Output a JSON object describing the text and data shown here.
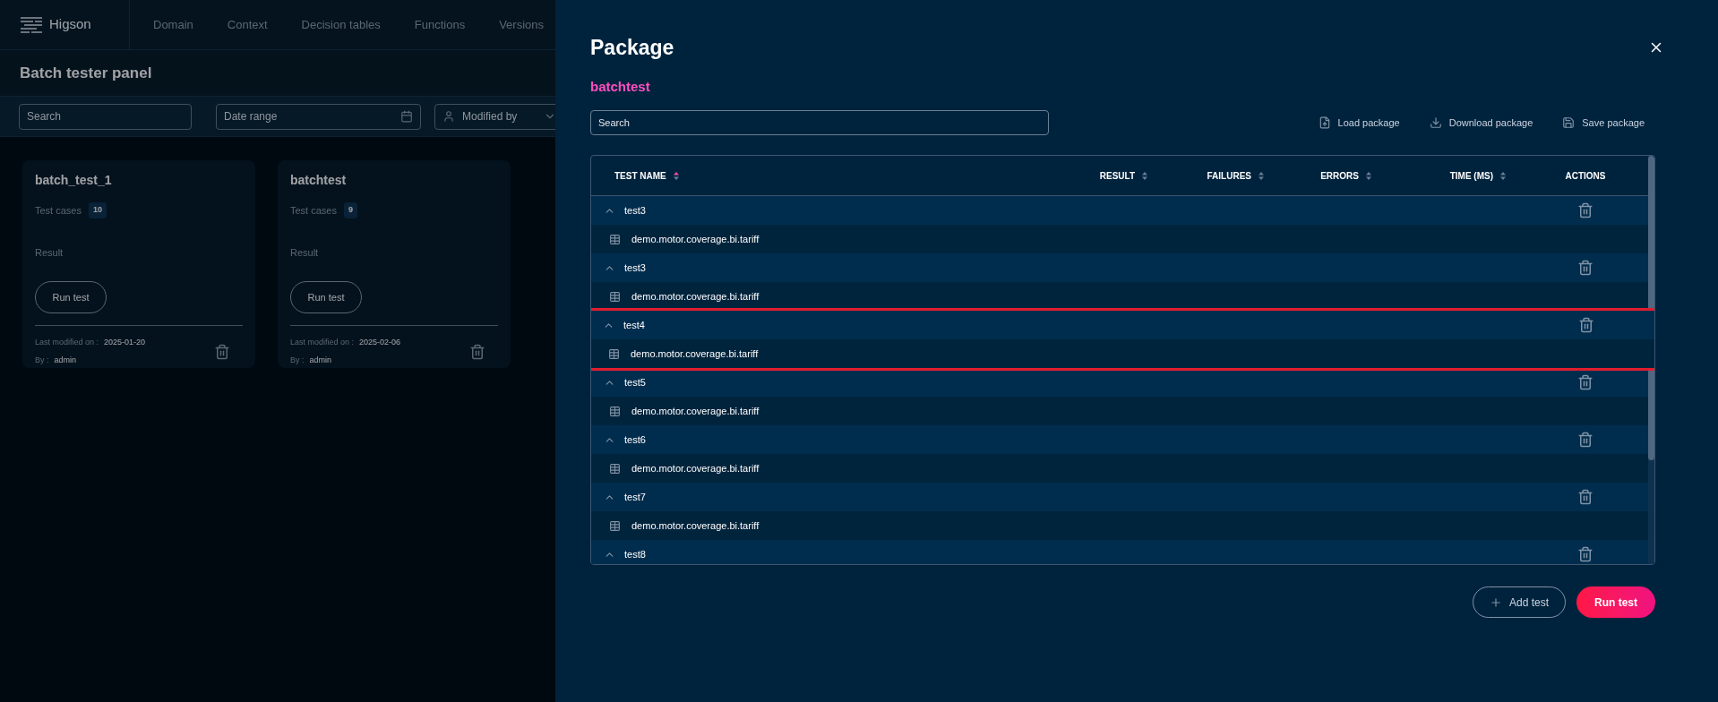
{
  "app": {
    "logo": "Higson",
    "nav": [
      {
        "label": "Domain"
      },
      {
        "label": "Context"
      },
      {
        "label": "Decision tables"
      },
      {
        "label": "Functions"
      },
      {
        "label": "Versions"
      }
    ]
  },
  "page": {
    "title": "Batch tester panel",
    "filters": {
      "search": {
        "placeholder": "Search"
      },
      "date_range": {
        "placeholder": "Date range"
      },
      "modified_by": {
        "placeholder": "Modified by"
      }
    },
    "cards": [
      {
        "name": "batch_test_1",
        "cases_label": "Test cases",
        "cases": "10",
        "result_label": "Result",
        "button": "Run test",
        "modified_label": "Last modified on :",
        "modified": "2025-01-20",
        "by_label": "By :",
        "by": "admin"
      },
      {
        "name": "batchtest",
        "cases_label": "Test cases",
        "cases": "9",
        "result_label": "Result",
        "button": "Run test",
        "modified_label": "Last modified on :",
        "modified": "2025-02-06",
        "by_label": "By :",
        "by": "admin"
      }
    ]
  },
  "drawer": {
    "title": "Package",
    "subtitle": "batchtest",
    "search": {
      "placeholder": "Search"
    },
    "actions": [
      {
        "kind": "load",
        "label": "Load package"
      },
      {
        "kind": "download",
        "label": "Download package"
      },
      {
        "kind": "save",
        "label": "Save package"
      }
    ],
    "table": {
      "columns": [
        {
          "label": "TEST NAME",
          "sorted": true
        },
        {
          "label": "RESULT",
          "sorted": false
        },
        {
          "label": "FAILURES",
          "sorted": false
        },
        {
          "label": "ERRORS",
          "sorted": false
        },
        {
          "label": "TIME (MS)",
          "sorted": false
        },
        {
          "label": "ACTIONS"
        }
      ],
      "groups": [
        {
          "name": "test3",
          "expanded": true,
          "highlighted": false,
          "children": [
            {
              "name": "demo.motor.coverage.bi.tariff"
            }
          ]
        },
        {
          "name": "test3",
          "expanded": true,
          "highlighted": false,
          "children": [
            {
              "name": "demo.motor.coverage.bi.tariff"
            }
          ]
        },
        {
          "name": "test4",
          "expanded": true,
          "highlighted": true,
          "children": [
            {
              "name": "demo.motor.coverage.bi.tariff"
            }
          ]
        },
        {
          "name": "test5",
          "expanded": true,
          "highlighted": false,
          "children": [
            {
              "name": "demo.motor.coverage.bi.tariff"
            }
          ]
        },
        {
          "name": "test6",
          "expanded": true,
          "highlighted": false,
          "children": [
            {
              "name": "demo.motor.coverage.bi.tariff"
            }
          ]
        },
        {
          "name": "test7",
          "expanded": true,
          "highlighted": false,
          "children": [
            {
              "name": "demo.motor.coverage.bi.tariff"
            }
          ]
        },
        {
          "name": "test8",
          "expanded": true,
          "highlighted": false
        }
      ]
    },
    "buttons": [
      {
        "kind": "secondary",
        "label": "Add test"
      },
      {
        "kind": "primary",
        "label": "Run test"
      }
    ]
  }
}
